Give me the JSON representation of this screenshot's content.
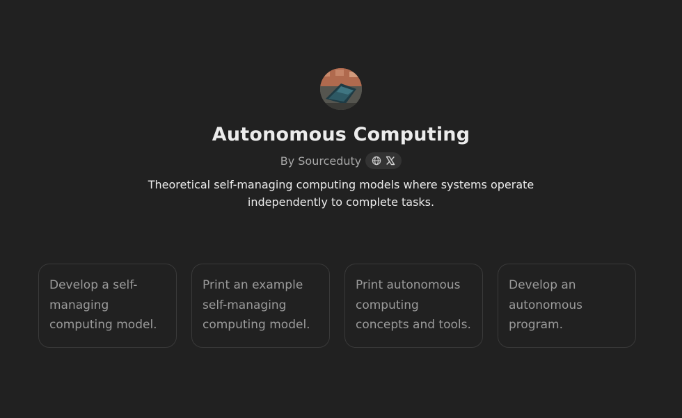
{
  "gpt": {
    "title": "Autonomous Computing",
    "by_label": "By Sourceduty",
    "description": "Theoretical self-managing computing models where systems operate independently to complete tasks.",
    "social_icons": [
      "globe-icon",
      "x-logo-icon"
    ]
  },
  "starters": [
    {
      "text": "Develop a self-managing computing model."
    },
    {
      "text": "Print an example self-managing computing model."
    },
    {
      "text": "Print autonomous computing concepts and tools."
    },
    {
      "text": "Develop an autonomous program."
    }
  ],
  "colors": {
    "background": "#212121",
    "text_primary": "#ececec",
    "text_secondary": "#a8a8a8",
    "card_border": "#3a3a3a",
    "card_text": "#9b9b9b",
    "pill_bg": "#333333"
  }
}
